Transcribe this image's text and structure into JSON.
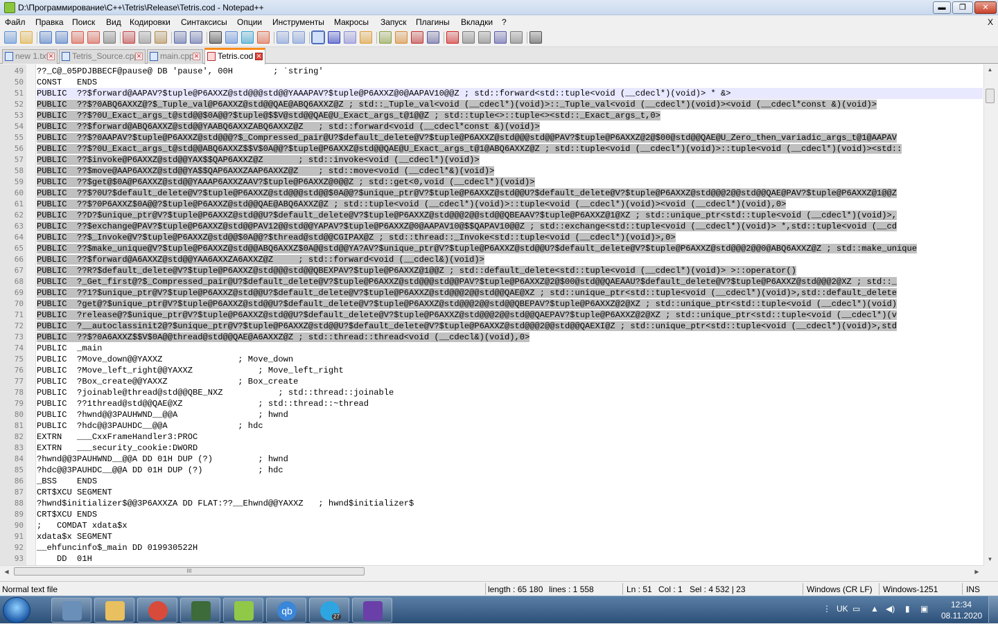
{
  "window": {
    "title": "D:\\Программирование\\C++\\Tetris\\Release\\Tetris.cod - Notepad++",
    "min_glyph": "▬",
    "max_glyph": "❐",
    "close_glyph": "✕"
  },
  "menu": [
    "Файл",
    "Правка",
    "Поиск",
    "Вид",
    "Кодировки",
    "Синтаксисы",
    "Опции",
    "Инструменты",
    "Макросы",
    "Запуск",
    "Плагины",
    "Вкладки",
    "?"
  ],
  "menu_close": "X",
  "toolbar_icons": [
    "new-file-icon",
    "open-file-icon",
    "save-icon",
    "save-all-icon",
    "close-icon",
    "close-all-icon",
    "print-icon",
    "cut-icon",
    "copy-icon",
    "paste-icon",
    "undo-icon",
    "redo-icon",
    "find-icon",
    "replace-icon",
    "zoom-in-icon",
    "zoom-out-icon",
    "sync-vertical-icon",
    "sync-horizontal-icon",
    "word-wrap-icon",
    "show-all-chars-icon",
    "indent-guide-icon",
    "document-map-icon",
    "function-list-icon",
    "folder-workspace-icon",
    "monitoring-icon",
    "eye-icon",
    "record-macro-icon",
    "stop-macro-icon",
    "play-macro-icon",
    "run-macro-multiple-icon",
    "save-macro-icon",
    "hex-icon"
  ],
  "tabs": [
    {
      "label": "new 1.txt",
      "active": false,
      "icon_color": "blue"
    },
    {
      "label": "Tetris_Source.cpp",
      "active": false,
      "icon_color": "blue"
    },
    {
      "label": "main.cpp",
      "active": false,
      "icon_color": "blue"
    },
    {
      "label": "Tetris.cod",
      "active": true,
      "icon_color": "red"
    }
  ],
  "tab_close_glyph": "✕",
  "editor": {
    "current_line": 51,
    "lines": [
      {
        "n": "49",
        "text": "??_C@_05PDJBBECF@pause@ DB 'pause', 00H        ; `string'",
        "sel": false
      },
      {
        "n": "50",
        "text": "CONST   ENDS",
        "sel": false
      },
      {
        "n": "51",
        "text": "PUBLIC  ??$forward@AAPAV?$tuple@P6AXXZ@std@@@std@@YAAAPAV?$tuple@P6AXXZ@0@AAPAV10@@Z ; std::forward<std::tuple<void (__cdecl*)(void)> * &>",
        "sel": true
      },
      {
        "n": "52",
        "text": "PUBLIC  ??$?0ABQ6AXXZ@?$_Tuple_val@P6AXXZ@std@@QAE@ABQ6AXXZ@Z ; std::_Tuple_val<void (__cdecl*)(void)>::_Tuple_val<void (__cdecl*)(void)><void (__cdecl*const &)(void)>",
        "sel": true
      },
      {
        "n": "53",
        "text": "PUBLIC  ??$?0U_Exact_args_t@std@@$0A@@?$tuple@$$V@std@@QAE@U_Exact_args_t@1@@Z ; std::tuple<>::tuple<><std::_Exact_args_t,0>",
        "sel": true
      },
      {
        "n": "54",
        "text": "PUBLIC  ??$forward@ABQ6AXXZ@std@@YAABQ6AXXZABQ6AXXZ@Z   ; std::forward<void (__cdecl*const &)(void)>",
        "sel": true
      },
      {
        "n": "55",
        "text": "PUBLIC  ??$?0AAPAV?$tuple@P6AXXZ@std@@@?$_Compressed_pair@U?$default_delete@V?$tuple@P6AXXZ@std@@@std@@PAV?$tuple@P6AXXZ@2@$00@std@@QAE@U_Zero_then_variadic_args_t@1@AAPAV",
        "sel": true
      },
      {
        "n": "56",
        "text": "PUBLIC  ??$?0U_Exact_args_t@std@@ABQ6AXXZ$$V$0A@@?$tuple@P6AXXZ@std@@QAE@U_Exact_args_t@1@ABQ6AXXZ@Z ; std::tuple<void (__cdecl*)(void)>::tuple<void (__cdecl*)(void)><std::",
        "sel": true
      },
      {
        "n": "57",
        "text": "PUBLIC  ??$invoke@P6AXXZ@std@@YAX$$QAP6AXXZ@Z       ; std::invoke<void (__cdecl*)(void)>",
        "sel": true
      },
      {
        "n": "58",
        "text": "PUBLIC  ??$move@AAP6AXXZ@std@@YA$$QAP6AXXZAAP6AXXZ@Z    ; std::move<void (__cdecl*&)(void)>",
        "sel": true
      },
      {
        "n": "59",
        "text": "PUBLIC  ??$get@$0A@P6AXXZ@std@@YAAAP6AXXZAAV?$tuple@P6AXXZ@0@@Z ; std::get<0,void (__cdecl*)(void)>",
        "sel": true
      },
      {
        "n": "60",
        "text": "PUBLIC  ??$?0U?$default_delete@V?$tuple@P6AXXZ@std@@@std@@$0A@@?$unique_ptr@V?$tuple@P6AXXZ@std@@U?$default_delete@V?$tuple@P6AXXZ@std@@@2@@std@@QAE@PAV?$tuple@P6AXXZ@1@@Z",
        "sel": true
      },
      {
        "n": "61",
        "text": "PUBLIC  ??$?0P6AXXZ$0A@@?$tuple@P6AXXZ@std@@QAE@ABQ6AXXZ@Z ; std::tuple<void (__cdecl*)(void)>::tuple<void (__cdecl*)(void)><void (__cdecl*)(void),0>",
        "sel": true
      },
      {
        "n": "62",
        "text": "PUBLIC  ??D?$unique_ptr@V?$tuple@P6AXXZ@std@@U?$default_delete@V?$tuple@P6AXXZ@std@@@2@@std@@QBEAAV?$tuple@P6AXXZ@1@XZ ; std::unique_ptr<std::tuple<void (__cdecl*)(void)>,",
        "sel": true
      },
      {
        "n": "63",
        "text": "PUBLIC  ??$exchange@PAV?$tuple@P6AXXZ@std@@PAV12@@std@@YAPAV?$tuple@P6AXXZ@0@AAPAV10@$$QAPAV10@@Z ; std::exchange<std::tuple<void (__cdecl*)(void)> *,std::tuple<void (__cd",
        "sel": true
      },
      {
        "n": "64",
        "text": "PUBLIC  ??$_Invoke@V?$tuple@P6AXXZ@std@@$0A@@?$thread@std@@CGIPAX@Z ; std::thread::_Invoke<std::tuple<void (__cdecl*)(void)>,0>",
        "sel": true
      },
      {
        "n": "65",
        "text": "PUBLIC  ??$make_unique@V?$tuple@P6AXXZ@std@@ABQ6AXXZ$0A@@std@@YA?AV?$unique_ptr@V?$tuple@P6AXXZ@std@@U?$default_delete@V?$tuple@P6AXXZ@std@@@2@@0@ABQ6AXXZ@Z ; std::make_unique",
        "sel": true
      },
      {
        "n": "66",
        "text": "PUBLIC  ??$forward@A6AXXZ@std@@YAA6AXXZA6AXXZ@Z     ; std::forward<void (__cdecl&)(void)>",
        "sel": true
      },
      {
        "n": "67",
        "text": "PUBLIC  ??R?$default_delete@V?$tuple@P6AXXZ@std@@@std@@QBEXPAV?$tuple@P6AXXZ@1@@Z ; std::default_delete<std::tuple<void (__cdecl*)(void)> >::operator()",
        "sel": true
      },
      {
        "n": "68",
        "text": "PUBLIC  ?_Get_first@?$_Compressed_pair@U?$default_delete@V?$tuple@P6AXXZ@std@@@std@@PAV?$tuple@P6AXXZ@2@$00@std@@QAEAAU?$default_delete@V?$tuple@P6AXXZ@std@@@2@XZ ; std::_",
        "sel": true
      },
      {
        "n": "69",
        "text": "PUBLIC  ??1?$unique_ptr@V?$tuple@P6AXXZ@std@@U?$default_delete@V?$tuple@P6AXXZ@std@@@2@@std@@QAE@XZ ; std::unique_ptr<std::tuple<void (__cdecl*)(void)>,std::default_delete",
        "sel": true
      },
      {
        "n": "70",
        "text": "PUBLIC  ?get@?$unique_ptr@V?$tuple@P6AXXZ@std@@U?$default_delete@V?$tuple@P6AXXZ@std@@@2@@std@@QBEPAV?$tuple@P6AXXZ@2@XZ ; std::unique_ptr<std::tuple<void (__cdecl*)(void)",
        "sel": true
      },
      {
        "n": "71",
        "text": "PUBLIC  ?release@?$unique_ptr@V?$tuple@P6AXXZ@std@@U?$default_delete@V?$tuple@P6AXXZ@std@@@2@@std@@QAEPAV?$tuple@P6AXXZ@2@XZ ; std::unique_ptr<std::tuple<void (__cdecl*)(v",
        "sel": true
      },
      {
        "n": "72",
        "text": "PUBLIC  ?__autoclassinit2@?$unique_ptr@V?$tuple@P6AXXZ@std@@U?$default_delete@V?$tuple@P6AXXZ@std@@@2@@std@@QAEXI@Z ; std::unique_ptr<std::tuple<void (__cdecl*)(void)>,std",
        "sel": true
      },
      {
        "n": "73",
        "text": "PUBLIC  ??$?0A6AXXZ$$V$0A@@thread@std@@QAE@A6AXXZ@Z ; std::thread::thread<void (__cdecl&)(void),0>",
        "sel": true
      },
      {
        "n": "74",
        "text": "PUBLIC  _main",
        "sel": false
      },
      {
        "n": "75",
        "text": "PUBLIC  ?Move_down@@YAXXZ               ; Move_down",
        "sel": false
      },
      {
        "n": "76",
        "text": "PUBLIC  ?Move_left_right@@YAXXZ             ; Move_left_right",
        "sel": false
      },
      {
        "n": "77",
        "text": "PUBLIC  ?Box_create@@YAXXZ              ; Box_create",
        "sel": false
      },
      {
        "n": "78",
        "text": "PUBLIC  ?joinable@thread@std@@QBE_NXZ           ; std::thread::joinable",
        "sel": false
      },
      {
        "n": "79",
        "text": "PUBLIC  ??1thread@std@@QAE@XZ               ; std::thread::~thread",
        "sel": false
      },
      {
        "n": "80",
        "text": "PUBLIC  ?hwnd@@3PAUHWND__@@A                ; hwnd",
        "sel": false
      },
      {
        "n": "81",
        "text": "PUBLIC  ?hdc@@3PAUHDC__@@A              ; hdc",
        "sel": false
      },
      {
        "n": "82",
        "text": "EXTRN   ___CxxFrameHandler3:PROC",
        "sel": false
      },
      {
        "n": "83",
        "text": "EXTRN   ___security_cookie:DWORD",
        "sel": false
      },
      {
        "n": "84",
        "text": "?hwnd@@3PAUHWND__@@A DD 01H DUP (?)         ; hwnd",
        "sel": false
      },
      {
        "n": "85",
        "text": "?hdc@@3PAUHDC__@@A DD 01H DUP (?)           ; hdc",
        "sel": false
      },
      {
        "n": "86",
        "text": "_BSS    ENDS",
        "sel": false
      },
      {
        "n": "87",
        "text": "CRT$XCU SEGMENT",
        "sel": false
      },
      {
        "n": "88",
        "text": "?hwnd$initializer$@@3P6AXXZA DD FLAT:??__Ehwnd@@YAXXZ   ; hwnd$initializer$",
        "sel": false
      },
      {
        "n": "89",
        "text": "CRT$XCU ENDS",
        "sel": false
      },
      {
        "n": "90",
        "text": ";   COMDAT xdata$x",
        "sel": false
      },
      {
        "n": "91",
        "text": "xdata$x SEGMENT",
        "sel": false
      },
      {
        "n": "92",
        "text": "__ehfuncinfo$_main DD 019930522H",
        "sel": false
      },
      {
        "n": "93",
        "text": "    DD  01H",
        "sel": false
      }
    ]
  },
  "hscroll_grip": "III",
  "status": {
    "file_type": "Normal text file",
    "length": "length : 65 180",
    "lines": "lines : 1 558",
    "ln": "Ln : 51",
    "col": "Col : 1",
    "sel": "Sel : 4 532 | 23",
    "eol": "Windows (CR LF)",
    "encoding": "Windows-1251",
    "ins": "INS"
  },
  "taskbar": {
    "apps": [
      {
        "name": "control-panel",
        "color": "#6a8fb8"
      },
      {
        "name": "explorer",
        "color": "#e8c060"
      },
      {
        "name": "chrome",
        "color": "#d84a3a"
      },
      {
        "name": "terminal",
        "color": "#3d6b3a"
      },
      {
        "name": "notepadpp",
        "color": "#90c848"
      },
      {
        "name": "qbittorrent",
        "color": "#3a86d8"
      },
      {
        "name": "telegram",
        "color": "#2ea5e0"
      },
      {
        "name": "visual-studio",
        "color": "#6a3fa8"
      }
    ],
    "qb_label": "qb",
    "telegram_badge": "27",
    "lang": "UK",
    "time": "12:34",
    "date": "08.11.2020"
  }
}
